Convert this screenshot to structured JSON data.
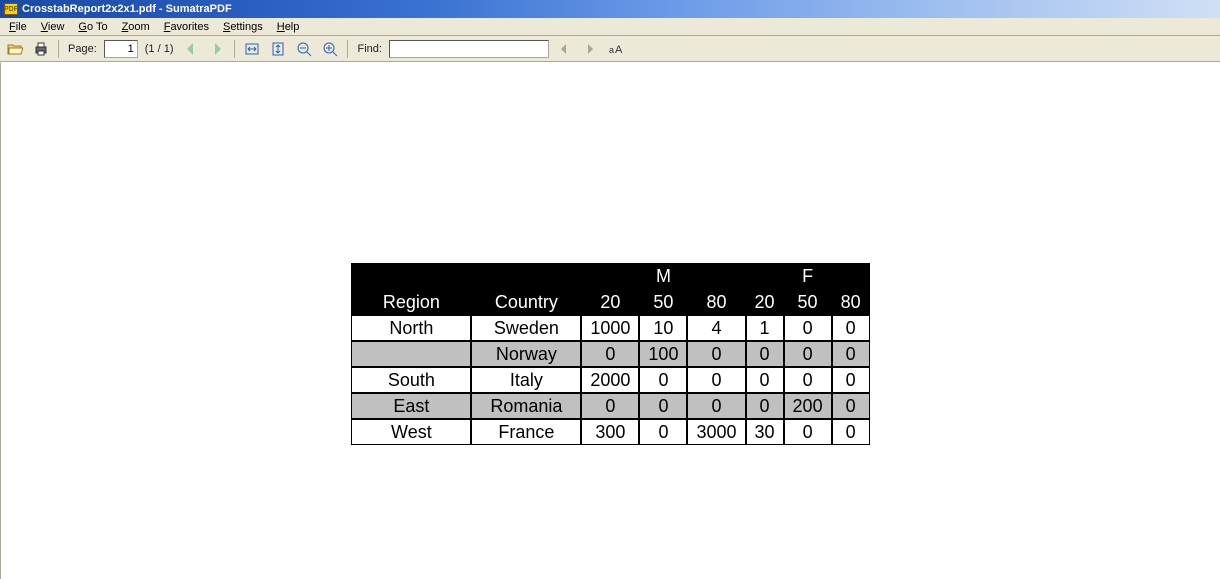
{
  "titlebar": {
    "title": "CrosstabReport2x2x1.pdf - SumatraPDF"
  },
  "menu": {
    "file": "File",
    "view": "View",
    "goto": "Go To",
    "zoom": "Zoom",
    "favorites": "Favorites",
    "settings": "Settings",
    "help": "Help"
  },
  "toolbar": {
    "page_label": "Page:",
    "page_current": "1",
    "page_count": "(1 / 1)",
    "find_label": "Find:",
    "find_value": ""
  },
  "chart_data": {
    "type": "table",
    "title": "",
    "column_groups": [
      "M",
      "F"
    ],
    "sub_columns": [
      "20",
      "50",
      "80"
    ],
    "row_headers": [
      "Region",
      "Country"
    ],
    "rows": [
      {
        "region": "North",
        "country": "Sweden",
        "values": [
          1000,
          10,
          4,
          1,
          0,
          0
        ]
      },
      {
        "region": "",
        "country": "Norway",
        "values": [
          0,
          100,
          0,
          0,
          0,
          0
        ]
      },
      {
        "region": "South",
        "country": "Italy",
        "values": [
          2000,
          0,
          0,
          0,
          0,
          0
        ]
      },
      {
        "region": "East",
        "country": "Romania",
        "values": [
          0,
          0,
          0,
          0,
          200,
          0
        ]
      },
      {
        "region": "West",
        "country": "France",
        "values": [
          300,
          0,
          3000,
          30,
          0,
          0
        ]
      }
    ]
  }
}
